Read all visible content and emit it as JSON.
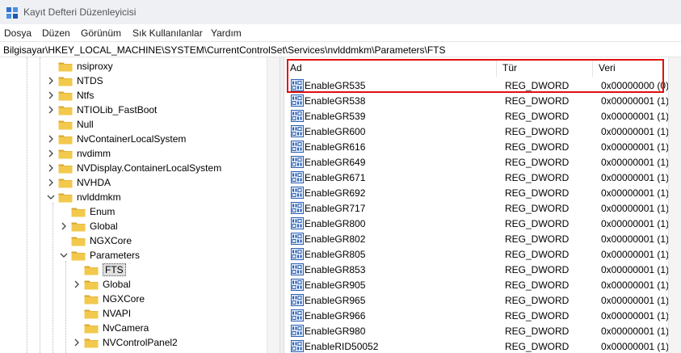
{
  "window": {
    "title": "Kayıt Defteri Düzenleyicisi"
  },
  "menu": [
    {
      "label": "Dosya"
    },
    {
      "label": "Düzen"
    },
    {
      "label": "Görünüm"
    },
    {
      "label": "Sık Kullanılanlar"
    },
    {
      "label": "Yardım"
    }
  ],
  "address": "Bilgisayar\\HKEY_LOCAL_MACHINE\\SYSTEM\\CurrentControlSet\\Services\\nvlddmkm\\Parameters\\FTS",
  "tree": [
    {
      "label": "nsiproxy",
      "depth": 0,
      "expander": "none"
    },
    {
      "label": "NTDS",
      "depth": 0,
      "expander": "collapsed"
    },
    {
      "label": "Ntfs",
      "depth": 0,
      "expander": "collapsed"
    },
    {
      "label": "NTIOLib_FastBoot",
      "depth": 0,
      "expander": "collapsed"
    },
    {
      "label": "Null",
      "depth": 0,
      "expander": "none"
    },
    {
      "label": "NvContainerLocalSystem",
      "depth": 0,
      "expander": "collapsed"
    },
    {
      "label": "nvdimm",
      "depth": 0,
      "expander": "collapsed"
    },
    {
      "label": "NVDisplay.ContainerLocalSystem",
      "depth": 0,
      "expander": "collapsed"
    },
    {
      "label": "NVHDA",
      "depth": 0,
      "expander": "collapsed"
    },
    {
      "label": "nvlddmkm",
      "depth": 0,
      "expander": "expanded"
    },
    {
      "label": "Enum",
      "depth": 1,
      "expander": "none"
    },
    {
      "label": "Global",
      "depth": 1,
      "expander": "collapsed"
    },
    {
      "label": "NGXCore",
      "depth": 1,
      "expander": "none"
    },
    {
      "label": "Parameters",
      "depth": 1,
      "expander": "expanded"
    },
    {
      "label": "FTS",
      "depth": 2,
      "expander": "none",
      "selected": true
    },
    {
      "label": "Global",
      "depth": 2,
      "expander": "collapsed"
    },
    {
      "label": "NGXCore",
      "depth": 2,
      "expander": "none"
    },
    {
      "label": "NVAPI",
      "depth": 2,
      "expander": "none"
    },
    {
      "label": "NvCamera",
      "depth": 2,
      "expander": "none"
    },
    {
      "label": "NVControlPanel2",
      "depth": 2,
      "expander": "collapsed"
    }
  ],
  "columns": {
    "name": "Ad",
    "type": "Tür",
    "data": "Veri"
  },
  "values": [
    {
      "name": "EnableGR535",
      "type": "REG_DWORD",
      "data": "0x00000000 (0)"
    },
    {
      "name": "EnableGR538",
      "type": "REG_DWORD",
      "data": "0x00000001 (1)"
    },
    {
      "name": "EnableGR539",
      "type": "REG_DWORD",
      "data": "0x00000001 (1)"
    },
    {
      "name": "EnableGR600",
      "type": "REG_DWORD",
      "data": "0x00000001 (1)"
    },
    {
      "name": "EnableGR616",
      "type": "REG_DWORD",
      "data": "0x00000001 (1)"
    },
    {
      "name": "EnableGR649",
      "type": "REG_DWORD",
      "data": "0x00000001 (1)"
    },
    {
      "name": "EnableGR671",
      "type": "REG_DWORD",
      "data": "0x00000001 (1)"
    },
    {
      "name": "EnableGR692",
      "type": "REG_DWORD",
      "data": "0x00000001 (1)"
    },
    {
      "name": "EnableGR717",
      "type": "REG_DWORD",
      "data": "0x00000001 (1)"
    },
    {
      "name": "EnableGR800",
      "type": "REG_DWORD",
      "data": "0x00000001 (1)"
    },
    {
      "name": "EnableGR802",
      "type": "REG_DWORD",
      "data": "0x00000001 (1)"
    },
    {
      "name": "EnableGR805",
      "type": "REG_DWORD",
      "data": "0x00000001 (1)"
    },
    {
      "name": "EnableGR853",
      "type": "REG_DWORD",
      "data": "0x00000001 (1)"
    },
    {
      "name": "EnableGR905",
      "type": "REG_DWORD",
      "data": "0x00000001 (1)"
    },
    {
      "name": "EnableGR965",
      "type": "REG_DWORD",
      "data": "0x00000001 (1)"
    },
    {
      "name": "EnableGR966",
      "type": "REG_DWORD",
      "data": "0x00000001 (1)"
    },
    {
      "name": "EnableGR980",
      "type": "REG_DWORD",
      "data": "0x00000001 (1)"
    },
    {
      "name": "EnableRID50052",
      "type": "REG_DWORD",
      "data": "0x00000001 (1)"
    }
  ],
  "colors": {
    "folder": "#f2c94c",
    "folder_dark": "#d9a62e",
    "highlight": "#e01010",
    "reg_icon": "#2b5fb3"
  },
  "icons": {
    "app": "registry-editor-icon",
    "folder": "folder-icon",
    "value": "reg-dword-icon",
    "collapsed": "chevron-right-icon",
    "expanded": "chevron-down-icon"
  }
}
